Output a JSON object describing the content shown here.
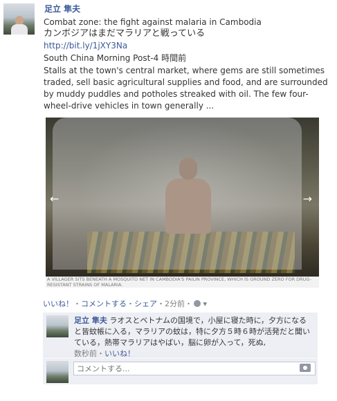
{
  "post": {
    "author": "足立 隼夫",
    "title_en": "Combat zone: the fight against malaria in Cambodia",
    "title_jp": "カンボジアはまだマラリアと戦っている",
    "link": "http://bit.ly/1jXY3Na",
    "source": "South China Morning Post-4 時間前",
    "excerpt": "Stalls at the town's central market, where gems are still sometimes traded, sell basic agricultural supplies and food, and are surrounded by muddy puddles and potholes streaked with oil. The few four-wheel-drive vehicles in town generally ...",
    "photo_caption": "A VILLAGER SITS BENEATH A MOSQUITO NET IN CAMBODIA'S PAILIN PROVINCE, WHICH IS GROUND ZERO FOR DRUG-RESISTANT STRAINS OF MALARIA."
  },
  "actions": {
    "like": "いいね！",
    "comment": "コメントする",
    "share": "シェア",
    "time": "2分前",
    "separator": "・"
  },
  "comment": {
    "author": "足立 隼夫",
    "text": "ラオスとベトナムの国境で，小屋に寝た時に，夕方になると皆蚊帳に入る，マラリアの蚊は，特に夕方５時６時が活発だと聞いている，熱帯マラリアはやばい，脳に卵が入って，死ぬ,",
    "time": "数秒前",
    "like": "いいね！"
  },
  "comment_input": {
    "placeholder": "コメントする..."
  },
  "icons": {
    "nav_left": "chevron-left-icon",
    "nav_right": "chevron-right-icon",
    "privacy": "globe-icon",
    "camera": "camera-icon"
  },
  "colors": {
    "link": "#3b5998",
    "comment_bg": "#edeff4",
    "meta": "#808080"
  }
}
